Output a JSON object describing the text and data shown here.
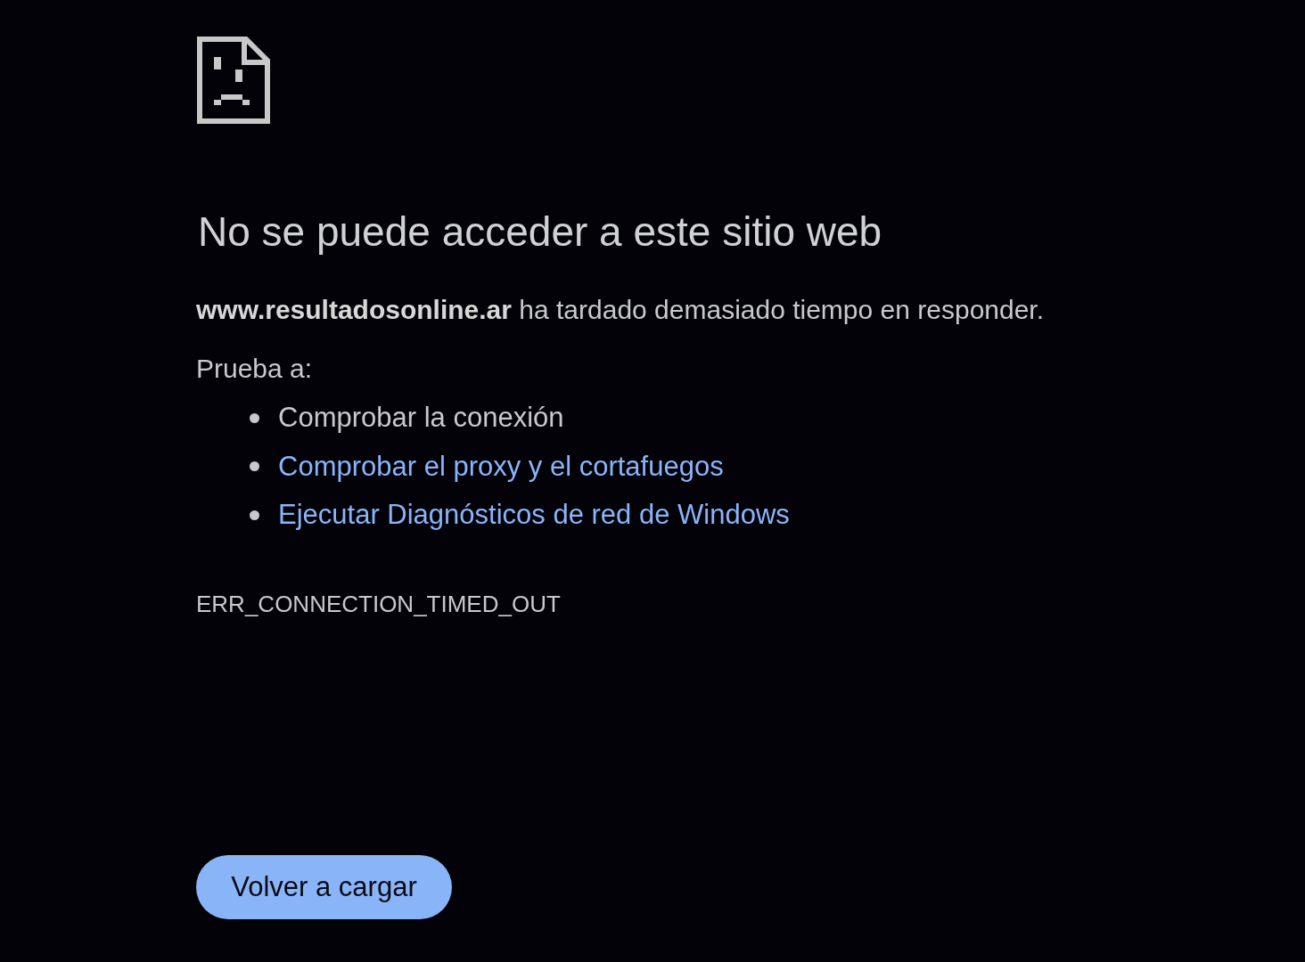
{
  "heading": "No se puede acceder a este sitio web",
  "message": "**www.resultadosonline.ar** ha tardado demasiado tiempo en responder.",
  "suggestions_label": "Prueba a:",
  "suggestions": [
    {
      "kind": "text",
      "label": "Comprobar la conexión"
    },
    {
      "kind": "link",
      "label": "Comprobar el proxy y el cortafuegos"
    },
    {
      "kind": "link",
      "label": "Ejecutar Diagnósticos de red de Windows"
    }
  ],
  "error_code": "ERR_CONNECTION_TIMED_OUT",
  "button": "Volver a cargar"
}
